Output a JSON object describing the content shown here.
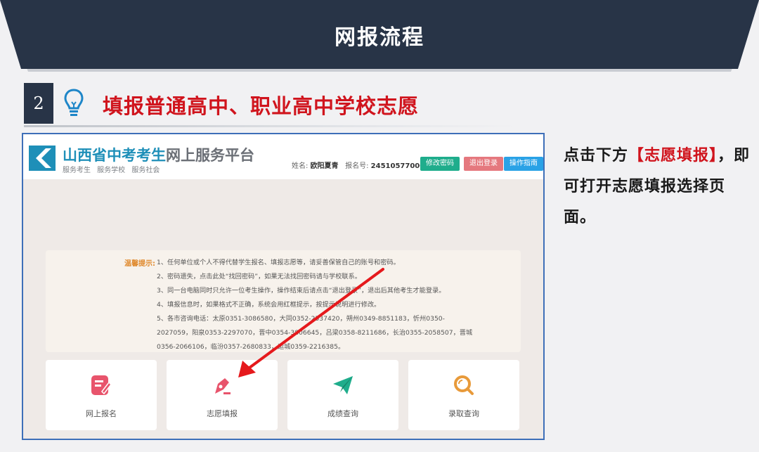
{
  "banner": {
    "title": "网报流程"
  },
  "step": {
    "number": "2",
    "title": "填报普通高中、职业高中学校志愿"
  },
  "site": {
    "title_part1": "山西省中考考生",
    "title_part2": "网上服务平台",
    "subtitle": "服务考生 服务学校 服务社会",
    "user_name_label": "姓名:",
    "user_name": "欧阳夏青",
    "reg_no_label": "报名号:",
    "reg_no": "245105770001",
    "buttons": {
      "change_password": "修改密码",
      "logout": "退出登录",
      "guide": "操作指南"
    },
    "notice_label": "温馨提示:",
    "notice_lines": [
      "1、任何单位或个人不得代替学生报名、填报志愿等，请妥善保管自己的账号和密码。",
      "2、密码遗失，点击此处“找回密码”，如果无法找回密码请与学校联系。",
      "3、同一台电脑同时只允许一位考生操作，操作结束后请点击“退出登录”，退出后其他考生才能登录。",
      "4、填报信息时，如果格式不正确，系统会用红框提示，按提示说明进行修改。",
      "5、各市咨询电话：太原0351-3086580，大同0352-2537420，朔州0349-8851183，忻州0350-",
      "2027059，阳泉0353-2297070，晋中0354-3806645，吕梁0358-8211686，长治0355-2058507，晋城",
      "0356-2066106，临汾0357-2680833，运城0359-2216385。"
    ],
    "cards": [
      {
        "label": "网上报名",
        "icon": "edit-icon",
        "color": "#e8546c"
      },
      {
        "label": "志愿填报",
        "icon": "pen-nib-icon",
        "color": "#e8546c"
      },
      {
        "label": "成绩查询",
        "icon": "paper-plane-icon",
        "color": "#1fad8c"
      },
      {
        "label": "录取查询",
        "icon": "search-icon",
        "color": "#e89a3a"
      }
    ]
  },
  "description": {
    "part1": "点击下方",
    "highlight": "【志愿填报】",
    "part2": "，即可打开志愿填报选择页面。"
  },
  "colors": {
    "banner": "#283447",
    "title_red": "#d0141d",
    "panel_border": "#3e6fb8",
    "arrow_red": "#e5191c"
  }
}
